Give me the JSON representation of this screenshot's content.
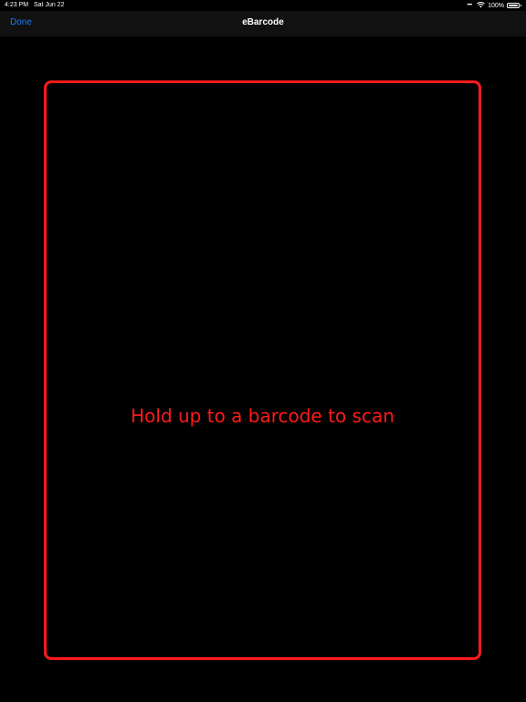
{
  "status_bar": {
    "time": "4:23 PM",
    "date": "Sat Jun 22",
    "battery_percent_label": "100%",
    "battery_level": 1.0,
    "wifi_icon": "wifi-icon",
    "battery_icon": "battery-icon"
  },
  "nav": {
    "done_label": "Done",
    "title": "eBarcode"
  },
  "scanner": {
    "prompt": "Hold up to a barcode to scan"
  },
  "colors": {
    "background": "#000000",
    "accent_blue": "#1a7cf5",
    "scan_red": "#ff1a1a"
  }
}
